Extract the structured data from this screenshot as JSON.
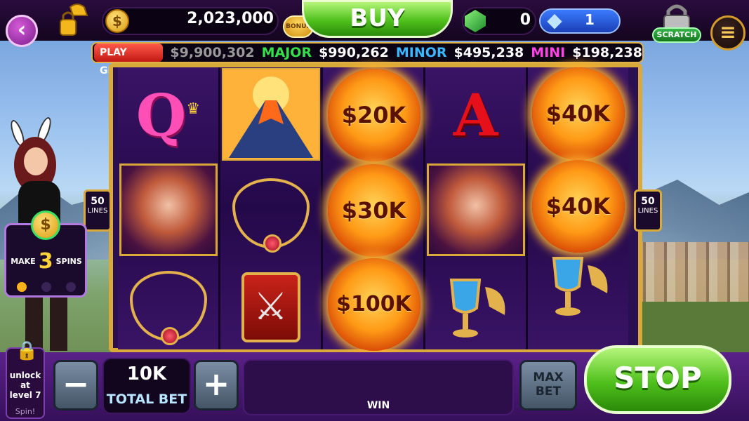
{
  "colors": {
    "accent_green": "#4fc01c",
    "gold": "#d9a93a",
    "purple": "#5a2189"
  },
  "header": {
    "back_icon": "back-arrow-icon",
    "coin_icon_glyph": "$",
    "coins": "2,023,000",
    "bonus_label": "BONUS",
    "buy_label": "BUY",
    "gems": "0",
    "diamonds": "1",
    "scratch_label": "SCRATCH",
    "menu_icon": "hamburger-icon"
  },
  "jackpots": {
    "grand_label": "PLAY GRAND",
    "grand_value": "$9,900,302",
    "major_label": "MAJOR",
    "major_value": "$990,262",
    "minor_label": "MINOR",
    "minor_value": "$495,238",
    "mini_label": "MINI",
    "mini_value": "$198,238"
  },
  "lines": {
    "count": "50",
    "label": "LINES"
  },
  "reels": {
    "col3_top": "$20K",
    "col3_mid": "$30K",
    "col3_bot": "$100K",
    "col4_top_letter": "A",
    "col1_top_letter": "Q",
    "col5_top": "$40K",
    "col5_mid": "$40K"
  },
  "mission": {
    "prefix": "MAKE",
    "number": "3",
    "suffix": "SPINS",
    "coin_glyph": "$",
    "progress_done": 1,
    "progress_total": 3
  },
  "footer": {
    "unlock_text_1": "unlock",
    "unlock_text_2": "at",
    "unlock_text_3": "level 7",
    "unlock_spin": "Spin!",
    "minus_label": "−",
    "bet_value": "10K",
    "bet_label": "TOTAL BET",
    "plus_label": "+",
    "win_label": "WIN",
    "max_bet_line1": "MAX",
    "max_bet_line2": "BET",
    "stop_label": "STOP"
  }
}
